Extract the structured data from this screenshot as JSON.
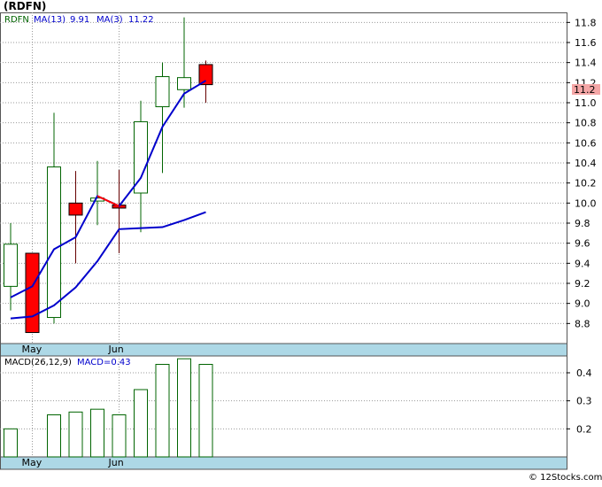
{
  "ticker_label": "(RDFN)",
  "credit": "© 12Stocks.com",
  "colors": {
    "up_outline": "#006400",
    "down_fill": "#ff0000",
    "ma_line": "#0000cc",
    "ma_short_overlay": "#ff0000",
    "axis_band": "#add8e6",
    "grid": "#999999",
    "price_marker_bg": "#f4a6a6"
  },
  "chart_data": [
    {
      "type": "candlestick",
      "title": "",
      "legend": {
        "ticker": "RDFN",
        "ma13_label": "MA(13)",
        "ma13_value": "9.91",
        "ma3_label": "MA(3)",
        "ma3_value": "11.22"
      },
      "last_price_label": "11.2",
      "last_price": 11.2,
      "ylim": [
        8.6,
        11.9
      ],
      "yticks": [
        8.8,
        9.0,
        9.2,
        9.4,
        9.6,
        9.8,
        10.0,
        10.2,
        10.4,
        10.6,
        10.8,
        11.0,
        11.2,
        11.4,
        11.6,
        11.8
      ],
      "ytick_labels": [
        "8.8",
        "9.0",
        "9.2",
        "9.4",
        "9.6",
        "9.8",
        "10.0",
        "10.2",
        "10.4",
        "10.6",
        "10.8",
        "11.0",
        "11.2",
        "11.4",
        "11.6",
        "11.8"
      ],
      "x_labels": [
        {
          "label": "May",
          "index": 1
        },
        {
          "label": "Jun",
          "index": 5
        }
      ],
      "candles": [
        {
          "open": 9.17,
          "close": 9.59,
          "high": 9.8,
          "low": 8.93
        },
        {
          "open": 9.5,
          "close": 8.71,
          "high": 9.5,
          "low": 8.71
        },
        {
          "open": 8.86,
          "close": 10.36,
          "high": 10.9,
          "low": 8.8
        },
        {
          "open": 10.0,
          "close": 9.88,
          "high": 10.32,
          "low": 9.4
        },
        {
          "open": 10.02,
          "close": 10.05,
          "high": 10.42,
          "low": 9.78
        },
        {
          "open": 9.98,
          "close": 9.95,
          "high": 10.33,
          "low": 9.5
        },
        {
          "open": 10.1,
          "close": 10.81,
          "high": 11.02,
          "low": 9.71
        },
        {
          "open": 10.96,
          "close": 11.26,
          "high": 11.4,
          "low": 10.3
        },
        {
          "open": 11.13,
          "close": 11.25,
          "high": 11.85,
          "low": 10.95
        },
        {
          "open": 11.38,
          "close": 11.18,
          "high": 11.42,
          "low": 11.0
        }
      ],
      "series": [
        {
          "name": "MA(13)",
          "values": [
            8.85,
            8.87,
            8.98,
            9.16,
            9.42,
            9.74,
            9.75,
            9.76,
            9.83,
            9.91
          ]
        },
        {
          "name": "MA(3)",
          "values": [
            9.06,
            9.17,
            9.54,
            9.66,
            10.07,
            9.97,
            10.25,
            10.76,
            11.09,
            11.22
          ]
        }
      ],
      "ma3_overlay_range": [
        4,
        5
      ]
    },
    {
      "type": "bar",
      "title": "",
      "legend": {
        "label": "MACD(26,12,9)",
        "value_label": "MACD=0.43"
      },
      "ylim": [
        0.1,
        0.46
      ],
      "yticks": [
        0.2,
        0.3,
        0.4
      ],
      "ytick_labels": [
        "0.2",
        "0.3",
        "0.4"
      ],
      "x_labels": [
        {
          "label": "May",
          "index": 1
        },
        {
          "label": "Jun",
          "index": 5
        }
      ],
      "values": [
        0.2,
        0.01,
        0.25,
        0.26,
        0.27,
        0.25,
        0.34,
        0.43,
        0.45,
        0.43
      ]
    }
  ]
}
